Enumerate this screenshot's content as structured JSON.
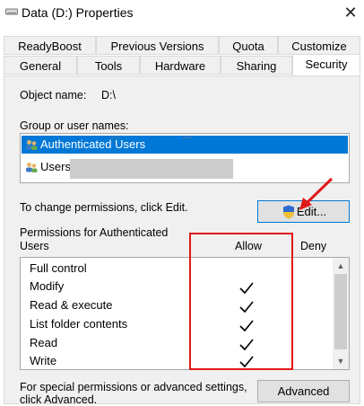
{
  "window": {
    "title": "Data (D:) Properties",
    "close": "✕"
  },
  "tabs": {
    "row1": [
      "ReadyBoost",
      "Previous Versions",
      "Quota",
      "Customize"
    ],
    "row2": [
      "General",
      "Tools",
      "Hardware",
      "Sharing",
      "Security"
    ],
    "active": "Security"
  },
  "security": {
    "object_label": "Object name:",
    "object_value": "D:\\",
    "group_label": "Group or user names:",
    "groups": [
      "Authenticated Users",
      "Users"
    ],
    "change_hint": "To change permissions, click Edit.",
    "edit_label": "Edit...",
    "perm_for_line1": "Permissions for Authenticated",
    "perm_for_line2": "Users",
    "allow_header": "Allow",
    "deny_header": "Deny",
    "permissions": [
      {
        "name": "Full control",
        "allow": false
      },
      {
        "name": "Modify",
        "allow": true
      },
      {
        "name": "Read & execute",
        "allow": true
      },
      {
        "name": "List folder contents",
        "allow": true
      },
      {
        "name": "Read",
        "allow": true
      },
      {
        "name": "Write",
        "allow": true
      }
    ],
    "special_line1": "For special permissions or advanced settings,",
    "special_line2": "click Advanced.",
    "advanced_label": "Advanced"
  },
  "colors": {
    "selection": "#0078d7",
    "annotation": "#e01919"
  }
}
